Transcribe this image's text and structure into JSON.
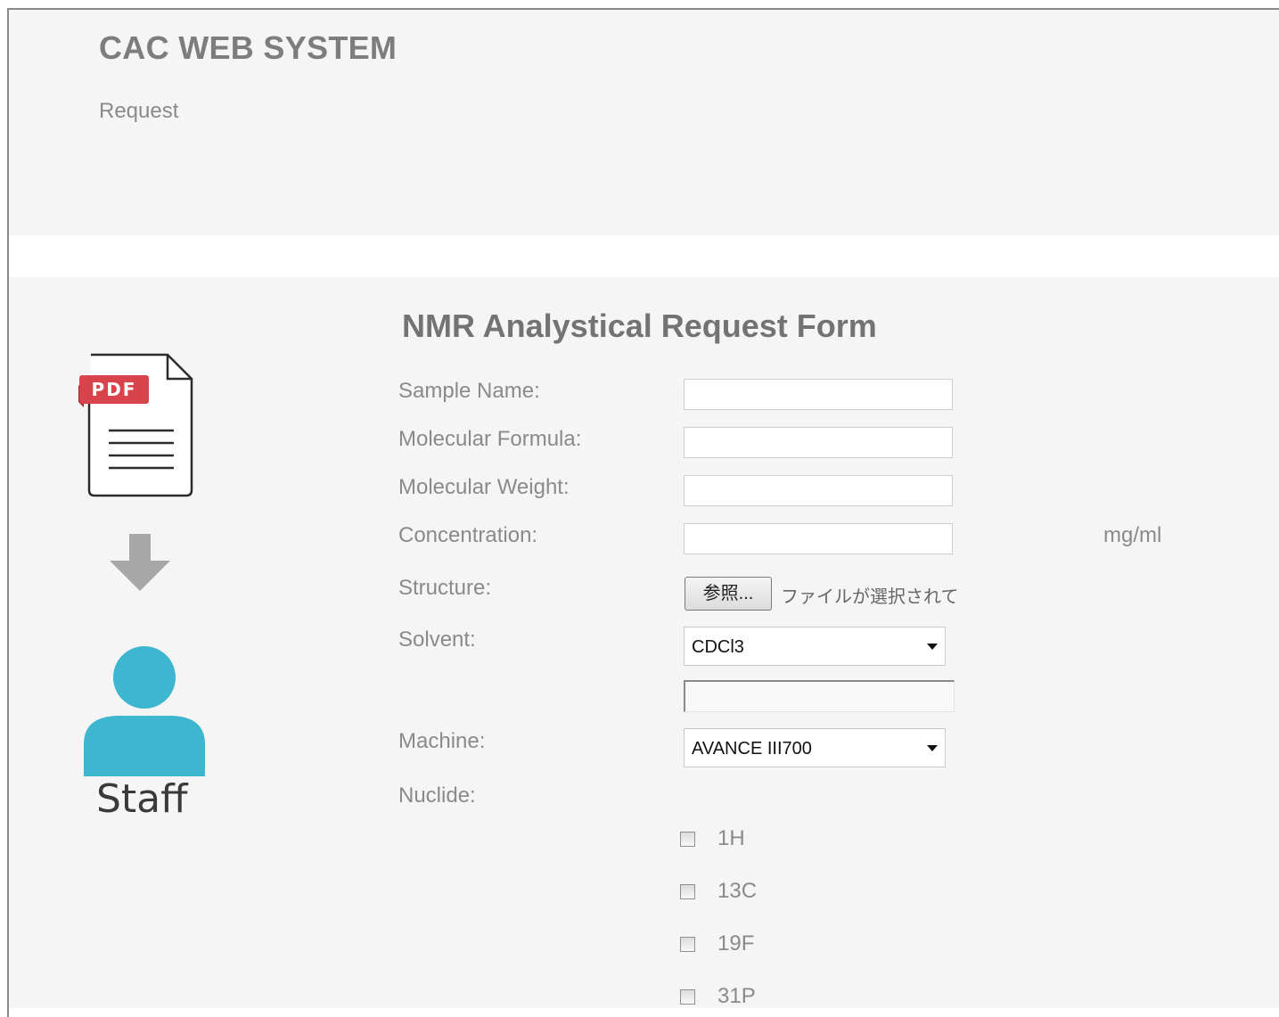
{
  "header": {
    "app_title": "CAC WEB SYSTEM",
    "nav_link": "Request"
  },
  "overlay": {
    "pdf_badge": "PDF",
    "staff_label": "Staff",
    "icon_color": "#3eb6cf",
    "pdf_badge_color": "#d9434b"
  },
  "form": {
    "title": "NMR Analystical Request Form",
    "sample_name_label": "Sample Name:",
    "sample_name_value": "",
    "formula_label": "Molecular Formula:",
    "formula_value": "",
    "weight_label": "Molecular Weight:",
    "weight_value": "",
    "concentration_label": "Concentration:",
    "concentration_value": "",
    "concentration_unit": "mg/ml",
    "structure_label": "Structure:",
    "file_button": "参照...",
    "file_status": "ファイルが選択されて",
    "solvent_label": "Solvent:",
    "solvent_value": "CDCl3",
    "solvent_other_value": "",
    "machine_label": "Machine:",
    "machine_value": "AVANCE III700",
    "nuclide_label": "Nuclide:",
    "nuclides": [
      {
        "label": "1H",
        "checked": false
      },
      {
        "label": "13C",
        "checked": false
      },
      {
        "label": "19F",
        "checked": false
      },
      {
        "label": "31P",
        "checked": false
      }
    ]
  }
}
